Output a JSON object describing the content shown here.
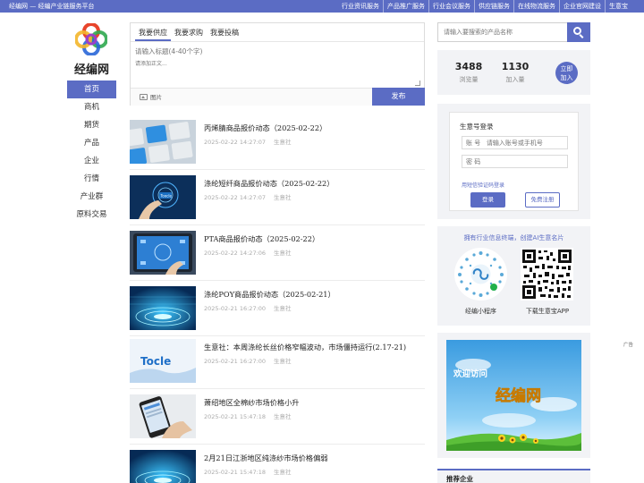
{
  "topbar": {
    "slogan": "经编网 — 经编产业链服务平台",
    "links": [
      "行业资讯服务",
      "产品推广服务",
      "行业会议服务",
      "供应链服务",
      "在线物流服务",
      "企业官网建设",
      "生意宝"
    ]
  },
  "brand": {
    "name": "经编网"
  },
  "nav": {
    "items": [
      "首页",
      "商机",
      "期货",
      "产品",
      "企业",
      "行情",
      "产业群",
      "原料交易"
    ]
  },
  "post": {
    "tabs": [
      "我要供应",
      "我要求购",
      "我要投稿"
    ],
    "title_placeholder": "请输入标题(4-40个字)",
    "content_placeholder": "请添加正文...",
    "image_label": "图片",
    "submit_label": "发布"
  },
  "news": [
    {
      "title": "丙烯腈商品报价动态（2025-02-22）",
      "date": "2025-02-22 14:27:07",
      "source": "生意社"
    },
    {
      "title": "涤纶短纤商品报价动态（2025-02-22）",
      "date": "2025-02-22 14:27:07",
      "source": "生意社"
    },
    {
      "title": "PTA商品报价动态（2025-02-22）",
      "date": "2025-02-22 14:27:06",
      "source": "生意社"
    },
    {
      "title": "涤纶POY商品报价动态（2025-02-21）",
      "date": "2025-02-21 16:27:00",
      "source": "生意社"
    },
    {
      "title": "生意社：本周涤纶长丝价格窄幅波动，市场僵持运行(2.17-21)",
      "date": "2025-02-21 16:27:00",
      "source": "生意社"
    },
    {
      "title": "萧绍地区全棉纱市场价格小升",
      "date": "2025-02-21 15:47:18",
      "source": "生意社"
    },
    {
      "title": "2月21日江浙地区纯涤纱市场价格偏弱",
      "date": "2025-02-21 15:47:18",
      "source": "生意社"
    }
  ],
  "thumb_text": {
    "toocle_a": "Toocle",
    "toocle_b": "Tocle"
  },
  "search": {
    "placeholder": "请输入要搜索的产品名称"
  },
  "stats": {
    "views": "3488",
    "views_label": "浏览量",
    "joined": "1130",
    "joined_label": "加入量",
    "join_line1": "立即",
    "join_line2": "加入"
  },
  "login": {
    "title": "生意号登录",
    "account_placeholder": "账 号   请输入账号或手机号",
    "password_placeholder": "密 码",
    "sms_link": "用短信验证码登录",
    "login_label": "登录",
    "register_label": "免费注册"
  },
  "app": {
    "tip": "拥有行业信息终端，创建AI生意名片",
    "miniprogram_label": "经编小程序",
    "download_label": "下载生意宝APP"
  },
  "ad": {
    "tag": "广告",
    "welcome": "欢迎访问",
    "brand": "经编网"
  },
  "recommend": {
    "title": "推荐企业"
  },
  "colors": {
    "accent": "#5b6cc4",
    "panel": "#f2f3f6"
  }
}
